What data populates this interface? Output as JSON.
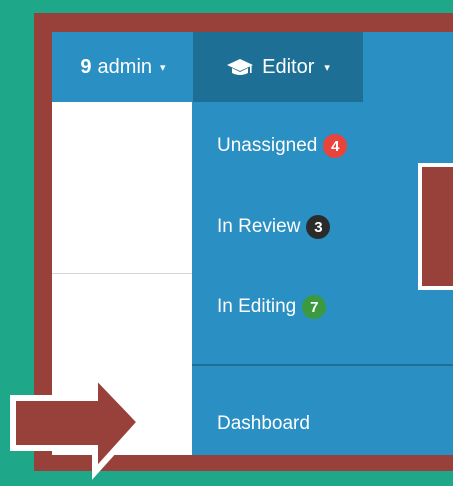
{
  "navbar": {
    "admin": {
      "icon": "user-icon",
      "label": "admin",
      "caret": "▾"
    },
    "editor": {
      "icon": "graduation-cap-icon",
      "label": "Editor",
      "caret": "▾"
    }
  },
  "dropdown": {
    "items": [
      {
        "label": "Unassigned",
        "badge": "4",
        "badge_color": "#e8443c"
      },
      {
        "label": "In Review",
        "badge": "3",
        "badge_color": "#2b2b2b"
      },
      {
        "label": "In Editing",
        "badge": "7",
        "badge_color": "#3b9a3f"
      }
    ],
    "dashboard": "Dashboard"
  },
  "colors": {
    "background": "#1ea889",
    "frame": "#97413a",
    "navbar": "#2a8fc2",
    "navbar_active": "#1e6f95"
  }
}
